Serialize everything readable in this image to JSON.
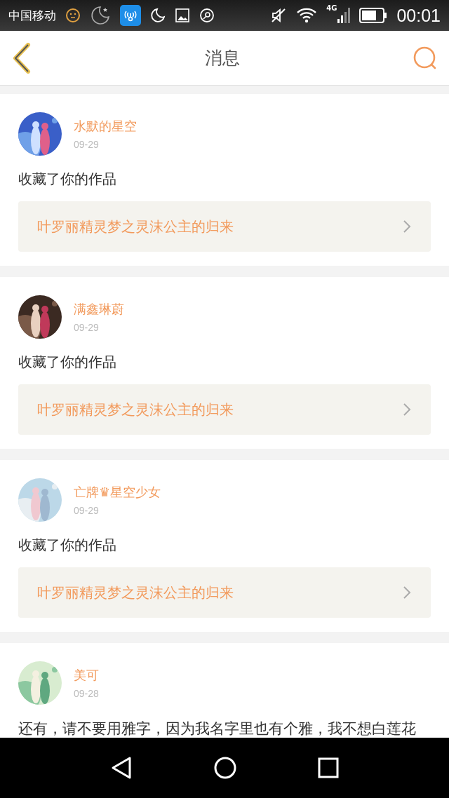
{
  "status_bar": {
    "carrier": "中国移动",
    "network": "4G",
    "time": "00:01"
  },
  "header": {
    "title": "消息"
  },
  "messages": [
    {
      "kind": "favorite",
      "name": "水默的星空",
      "date": "09-29",
      "action": "收藏了你的作品",
      "work": "叶罗丽精灵梦之灵沫公主的归来"
    },
    {
      "kind": "favorite",
      "name": "满鑫琳蔚",
      "date": "09-29",
      "action": "收藏了你的作品",
      "work": "叶罗丽精灵梦之灵沫公主的归来"
    },
    {
      "kind": "favorite",
      "name": "亡牌♛星空少女",
      "date": "09-29",
      "action": "收藏了你的作品",
      "work": "叶罗丽精灵梦之灵沫公主的归来"
    },
    {
      "kind": "comment",
      "name": "美可",
      "date": "09-28",
      "action": "还有，请不要用雅字，因为我名字里也有个雅，我不想白莲花"
    }
  ]
}
